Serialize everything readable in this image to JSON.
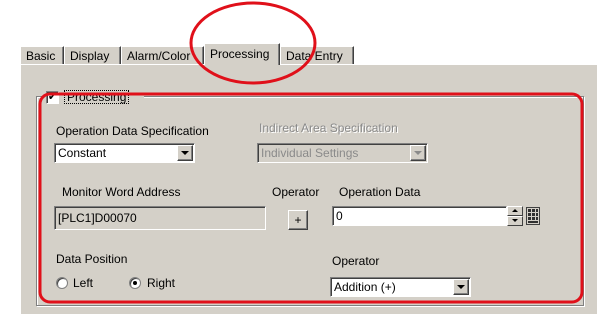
{
  "tabs": [
    {
      "label": "Basic"
    },
    {
      "label": "Display"
    },
    {
      "label": "Alarm/Color"
    },
    {
      "label": "Processing"
    },
    {
      "label": "Data Entry"
    }
  ],
  "active_tab": "Processing",
  "processing_group": {
    "checkbox_label": "Processing",
    "checked": true,
    "check_mark": "✔"
  },
  "operation_data_spec": {
    "label": "Operation Data Specification",
    "value": "Constant"
  },
  "indirect_area_spec": {
    "label": "Indirect Area Specification",
    "value": "Individual Settings",
    "enabled": false
  },
  "monitor_word_address": {
    "label": "Monitor Word Address",
    "value": "[PLC1]D00070"
  },
  "operator_top": {
    "label": "Operator",
    "value": "+"
  },
  "operation_data": {
    "label": "Operation Data",
    "value": "0"
  },
  "data_position": {
    "label": "Data Position",
    "options": [
      {
        "label": "Left",
        "selected": false
      },
      {
        "label": "Right",
        "selected": true
      }
    ]
  },
  "operator_bottom": {
    "label": "Operator",
    "value": "Addition (+)"
  },
  "annotation_colors": {
    "highlight": "#e0101a"
  }
}
